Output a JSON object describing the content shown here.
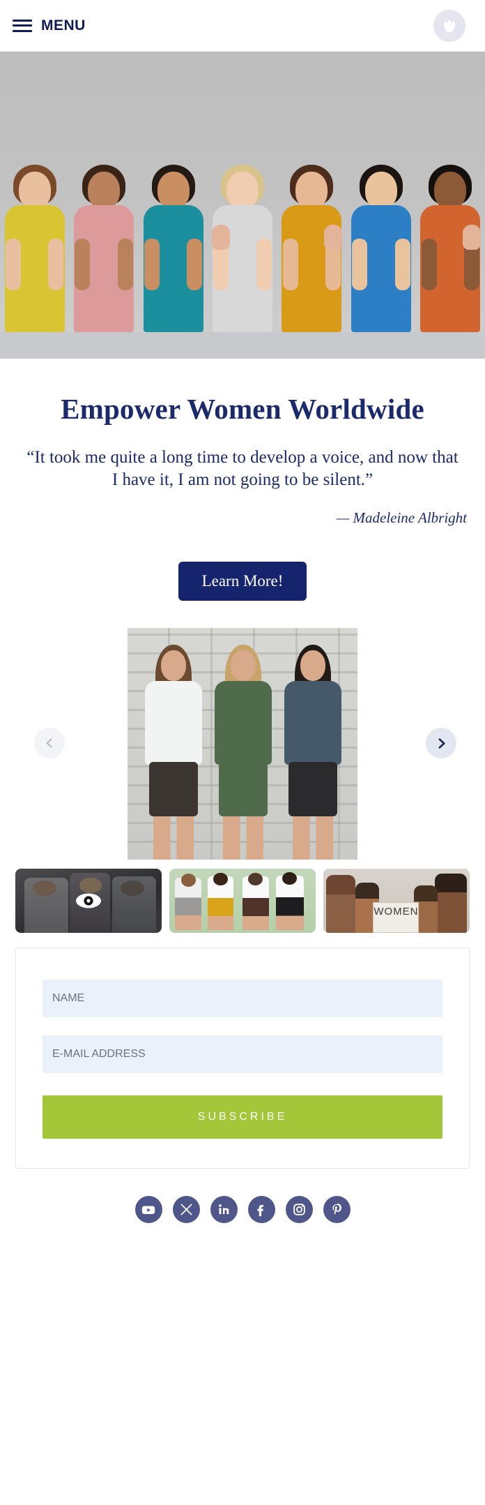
{
  "header": {
    "menu_label": "MENU",
    "hamburger_icon": "hamburger-menu-icon",
    "logo_icon": "brand-crown-logo-icon"
  },
  "hero": {
    "alt": "Group of diverse women giving thumbs up",
    "people": [
      {
        "shirt": "#d9c533",
        "hair": "#7b4a2a",
        "skin": "#e8c0a0"
      },
      {
        "shirt": "#dd9a9a",
        "hair": "#3a2416",
        "skin": "#b9825c"
      },
      {
        "shirt": "#1c8f9e",
        "hair": "#231a14",
        "skin": "#c98f62"
      },
      {
        "shirt": "#d8d8d8",
        "hair": "#d8c48b",
        "skin": "#f0cdb0"
      },
      {
        "shirt": "#d89a17",
        "hair": "#4c2d1c",
        "skin": "#e6b894"
      },
      {
        "shirt": "#2c7fc4",
        "hair": "#1c1410",
        "skin": "#e8c39c"
      },
      {
        "shirt": "#d2652f",
        "hair": "#14100d",
        "skin": "#8c5a37"
      }
    ]
  },
  "main": {
    "title": "Empower Women Worldwide",
    "quote": "“It took me quite a long time to develop a voice, and now that I have it, I am not going to be silent.”",
    "quote_author": "— Madeleine Albright",
    "cta_label": "Learn More!"
  },
  "carousel": {
    "prev_icon": "chevron-left-icon",
    "next_icon": "chevron-right-icon",
    "active_index": 0,
    "slide_alt": "Three women standing together against a white brick wall",
    "slide_figures": [
      {
        "top": "#f2f3f3",
        "bottom": "#3a3531",
        "hair": "#6b4a30"
      },
      {
        "top": "#4f6b4b",
        "bottom": "#4f6b4b",
        "hair": "#c8a36a"
      },
      {
        "top": "#46596b",
        "bottom": "#2b2b2e",
        "hair": "#221a16"
      }
    ],
    "thumbnails": [
      {
        "alt": "Three women dark preview",
        "selected": true,
        "overlay_icon": "eye-icon"
      },
      {
        "alt": "Four women in office attire on green background",
        "selected": false
      },
      {
        "alt": "Women holding a WOMEN protest sign",
        "selected": false,
        "sign_text": "WOMEN"
      }
    ]
  },
  "subscribe": {
    "name_placeholder": "NAME",
    "name_value": "",
    "email_placeholder": "E-MAIL ADDRESS",
    "email_value": "",
    "button_label": "SUBSCRIBE",
    "button_color": "#a4c639"
  },
  "social": {
    "items": [
      {
        "name": "youtube-icon",
        "label": "YouTube"
      },
      {
        "name": "x-twitter-icon",
        "label": "X"
      },
      {
        "name": "linkedin-icon",
        "label": "LinkedIn"
      },
      {
        "name": "facebook-icon",
        "label": "Facebook"
      },
      {
        "name": "instagram-icon",
        "label": "Instagram"
      },
      {
        "name": "pinterest-icon",
        "label": "Pinterest"
      }
    ],
    "circle_color": "#4f5689"
  },
  "theme": {
    "navy": "#16246d",
    "title_navy": "#1b2a6b",
    "field_bg": "#eaf1fb",
    "green": "#a4c639"
  }
}
